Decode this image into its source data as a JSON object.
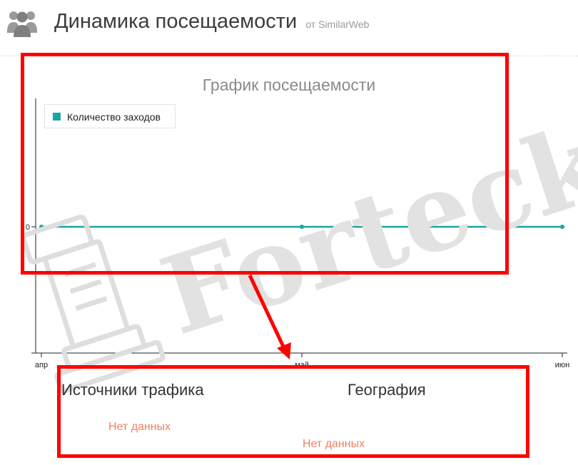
{
  "header": {
    "title": "Динамика посещаемости",
    "source": "от SimilarWeb"
  },
  "chart_data": {
    "type": "line",
    "title": "График посещаемости",
    "x": [
      "апр",
      "май",
      "июн"
    ],
    "series": [
      {
        "name": "Количество заходов",
        "values": [
          0,
          0,
          0
        ],
        "color": "#1aa5a5"
      }
    ],
    "ylabel": "",
    "xlabel": "",
    "y_ticks": [
      "0"
    ],
    "legend": "top-left",
    "grid": false
  },
  "traffic_sources": {
    "title": "Источники трафика",
    "empty": "Нет данных"
  },
  "geography": {
    "title": "География",
    "empty": "Нет данных"
  },
  "annotation_color": "#ff0000",
  "watermark": "Forteck"
}
